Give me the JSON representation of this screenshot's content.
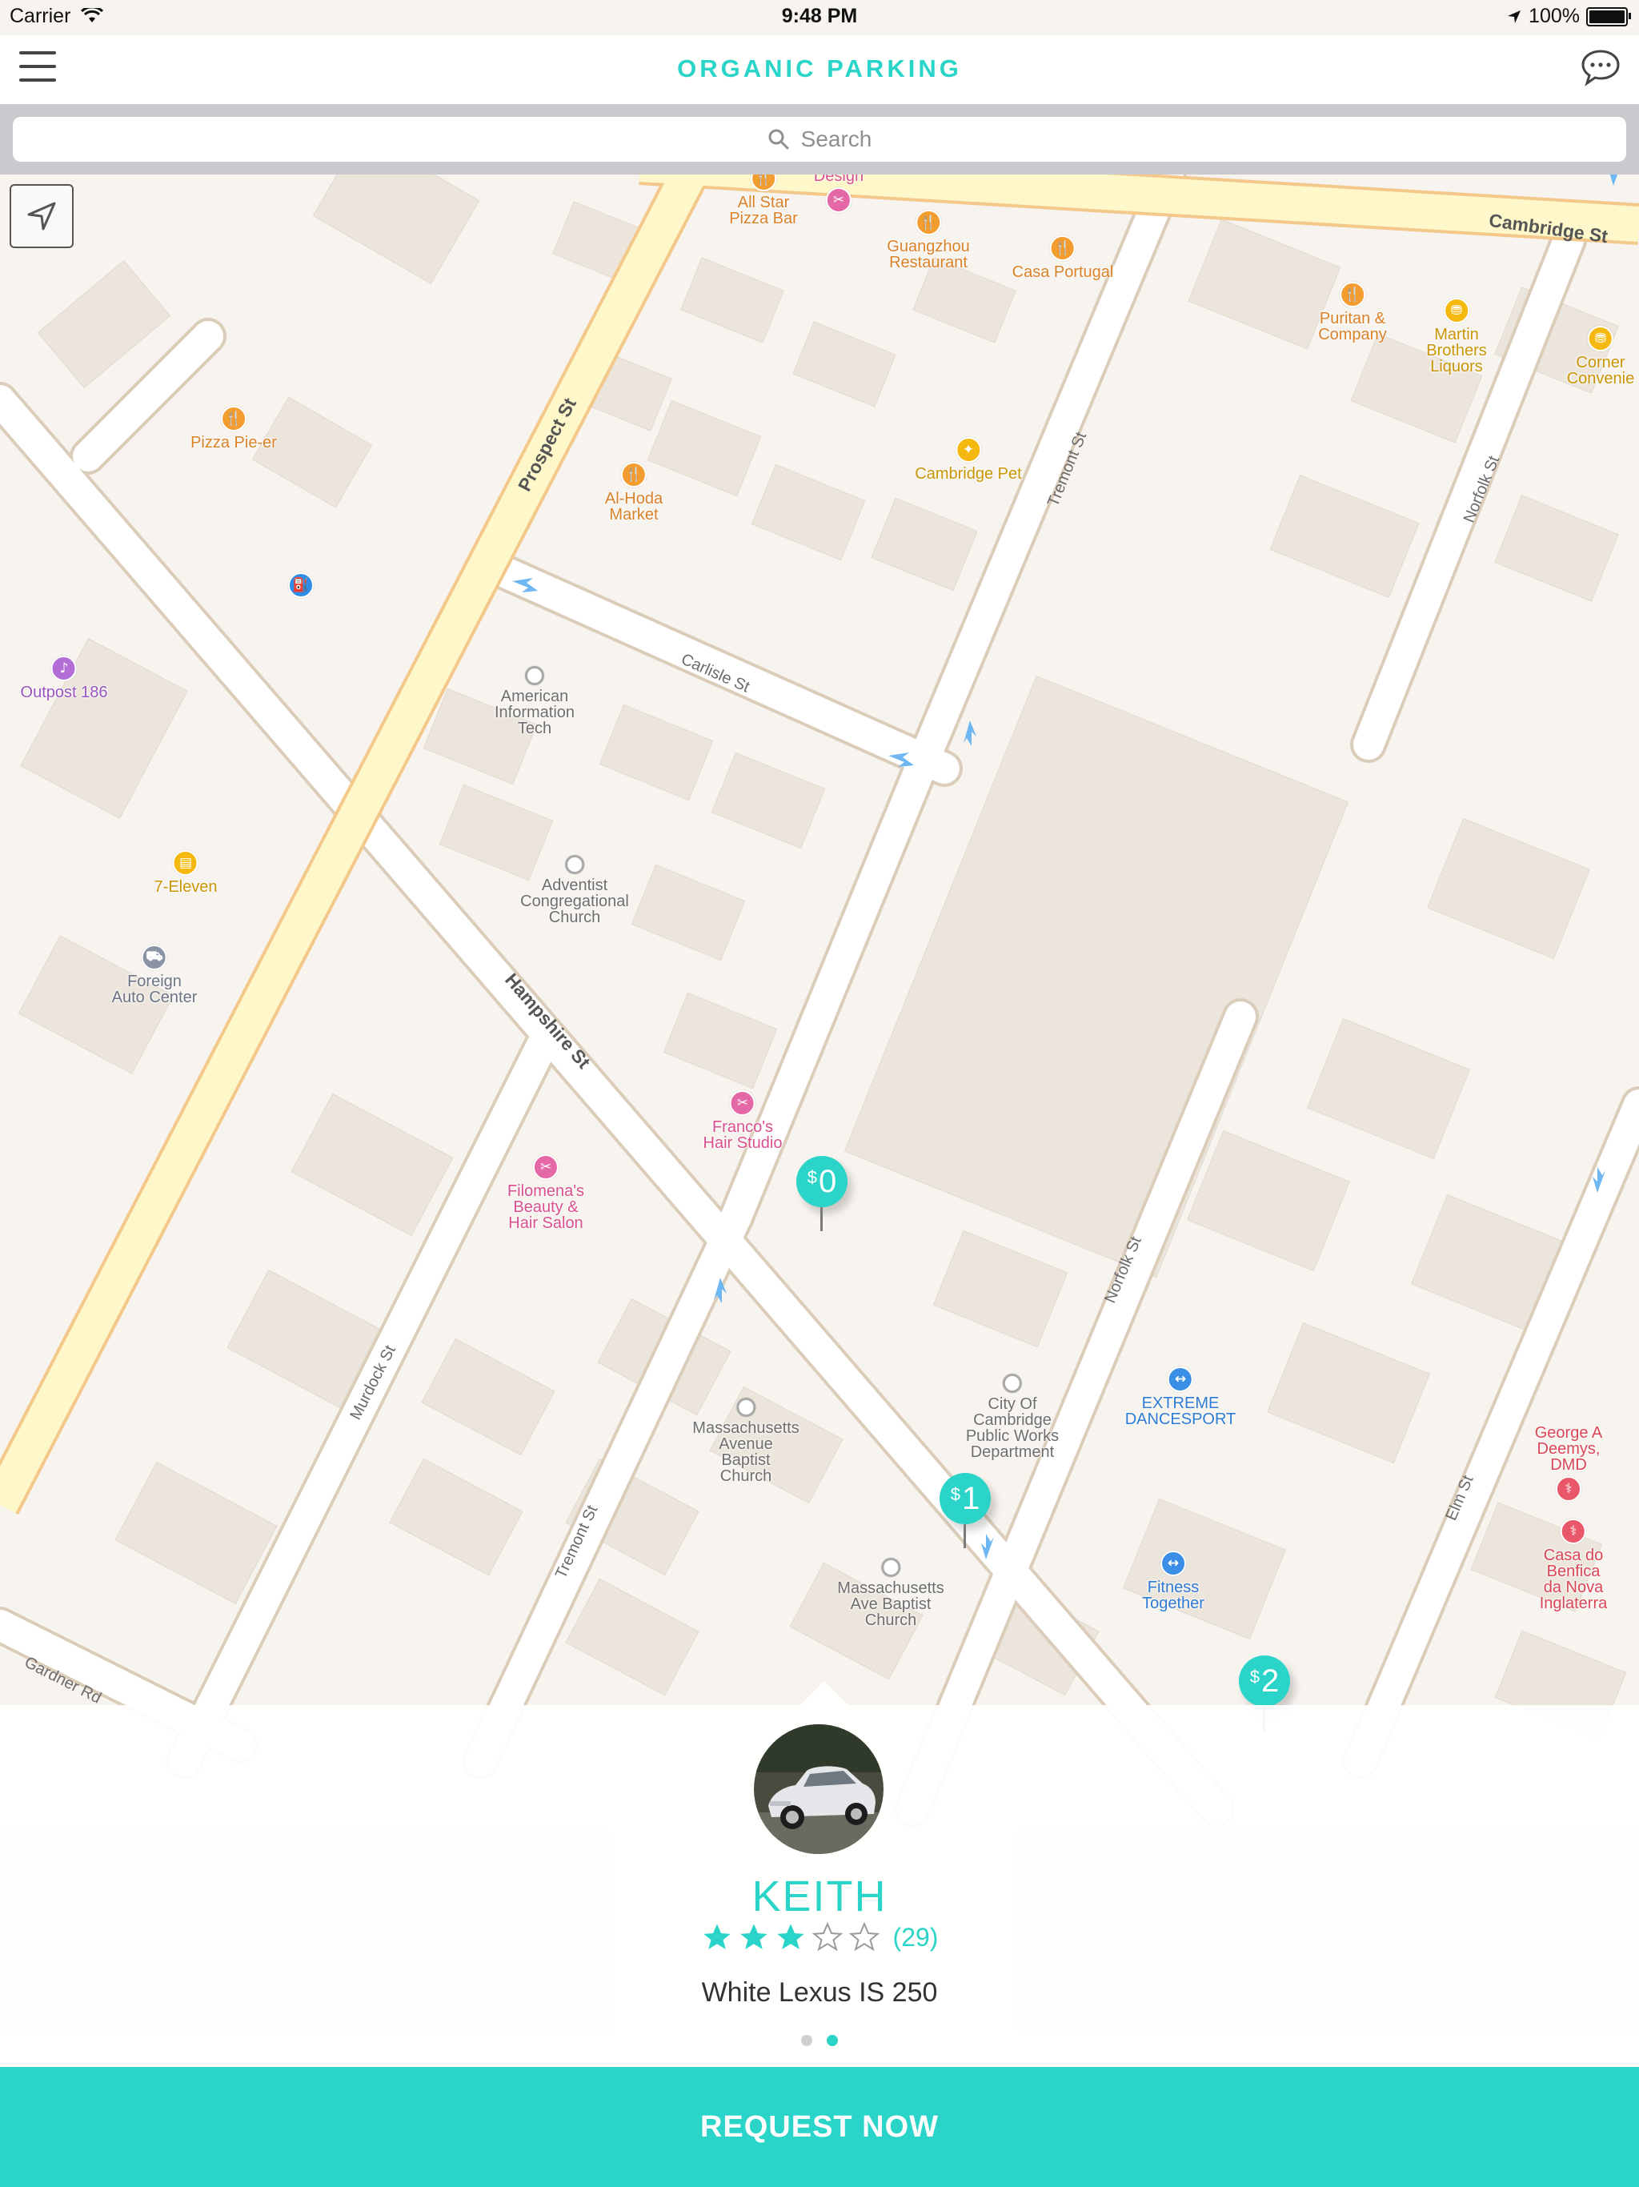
{
  "status_bar": {
    "carrier": "Carrier",
    "time": "9:48 PM",
    "battery": "100%"
  },
  "header": {
    "title": "ORGANIC PARKING",
    "menu_icon": "hamburger-menu-icon",
    "chat_icon": "chat-bubble-icon"
  },
  "search": {
    "placeholder": "Search"
  },
  "map": {
    "streets": {
      "cambridge": "Cambridge St",
      "prospect": "Prospect St",
      "tremont_north": "Tremont St",
      "norfolk_north": "Norfolk St",
      "carlisle": "Carlisle St",
      "hampshire": "Hampshire St",
      "murdock": "Murdock St",
      "tremont_south": "Tremont St",
      "norfolk_south": "Norfolk St",
      "elm": "Elm St",
      "gardner": "Gardner Rd"
    },
    "pois": {
      "all_star": "All Star\nPizza Bar",
      "design": "Design",
      "guangzhou": "Guangzhou\nRestaurant",
      "casa_portugal": "Casa Portugal",
      "puritan": "Puritan &\nCompany",
      "martin_brothers": "Martin\nBrothers\nLiquors",
      "corner": "Corner\nConvenie",
      "pizza_pie": "Pizza Pie-er",
      "al_hoda": "Al-Hoda\nMarket",
      "cambridge_pet": "Cambridge Pet",
      "outpost": "Outpost 186",
      "american_info": "American\nInformation\nTech",
      "seven_eleven": "7-Eleven",
      "adventist": "Adventist\nCongregational\nChurch",
      "foreign_auto": "Foreign\nAuto Center",
      "francos": "Franco's\nHair Studio",
      "filomenas": "Filomena's\nBeauty &\nHair Salon",
      "city_works": "City Of\nCambridge\nPublic Works\nDepartment",
      "extreme": "EXTREME\nDANCESPORT",
      "mass_ave_baptist": "Massachusetts\nAvenue\nBaptist\nChurch",
      "mass_ave_baptist2": "Massachusetts\nAve Baptist\nChurch",
      "fitness": "Fitness\nTogether",
      "george": "George A\nDeemys, DMD",
      "casa_benfica": "Casa do\nBenfica\nda Nova\nInglaterra"
    },
    "pins": [
      {
        "currency": "$",
        "amount": "0"
      },
      {
        "currency": "$",
        "amount": "1"
      },
      {
        "currency": "$",
        "amount": "2"
      }
    ]
  },
  "driver_card": {
    "name": "KEITH",
    "rating_stars": 3,
    "rating_max": 5,
    "rating_count": "(29)",
    "car": "White Lexus IS 250",
    "page_count": 2,
    "active_page": 2
  },
  "cta": {
    "label": "REQUEST NOW"
  },
  "colors": {
    "accent": "#2bd4c8",
    "map_background": "#f7f3ee",
    "road_major": "#fdf7c9"
  }
}
